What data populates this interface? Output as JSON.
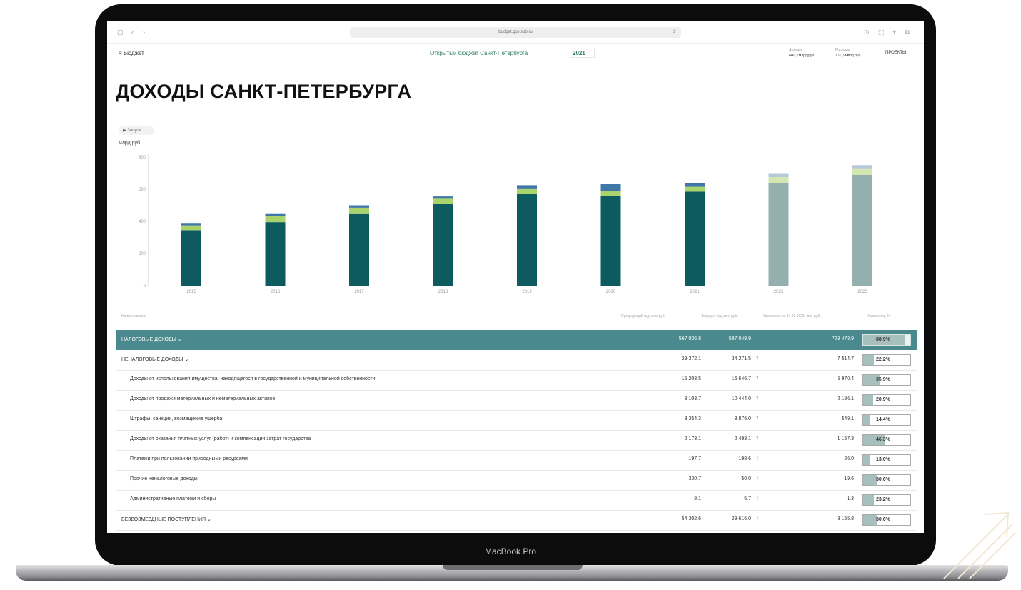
{
  "device": {
    "brand_label": "MacBook Pro"
  },
  "browser": {
    "url": "budget.gov.spb.ru",
    "zoom": "1"
  },
  "header": {
    "menu_label": "≡ Бюджет",
    "site_title": "Открытый бюджет Санкт-Петербурга",
    "year": "2021",
    "stats": [
      {
        "key": "Доходы",
        "value": "641,7 млрд руб."
      },
      {
        "key": "Расходы",
        "value": "761,5 млрд руб."
      }
    ],
    "projects_label": "ПРОЕКТЫ"
  },
  "page_title": "ДОХОДЫ САНКТ-ПЕТЕРБУРГА",
  "play_button_label": "▶ Запуск",
  "unit_label": "млрд руб.",
  "chart_data": {
    "type": "bar",
    "stacked": true,
    "categories": [
      "2015",
      "2016",
      "2017",
      "2018",
      "2019",
      "2020",
      "2021",
      "2022",
      "2023"
    ],
    "series": [
      {
        "values": [
          345,
          395,
          450,
          510,
          570,
          560,
          585,
          640,
          690
        ]
      },
      {
        "values": [
          30,
          40,
          35,
          35,
          35,
          30,
          30,
          35,
          40
        ]
      },
      {
        "values": [
          15,
          15,
          15,
          10,
          20,
          45,
          25,
          25,
          20
        ]
      }
    ],
    "forecast_from_index": 7,
    "ylim": [
      0,
      800
    ],
    "yticks": [
      0,
      200,
      400,
      600,
      800
    ],
    "colors": {
      "main": "#0d5b5f",
      "second": "#a9d36b",
      "third": "#3f78a8",
      "forecast_main": "#94b0ae",
      "forecast_second": "#d3e8b0",
      "forecast_third": "#b8c8d6"
    }
  },
  "table": {
    "headers": [
      "Наименование",
      "Предыдущий год, млн руб.",
      "Текущий год, млн руб.",
      "Исполнено на 01.01.2021, млн руб.",
      "Исполнено, %"
    ],
    "rows": [
      {
        "label": "НАЛОГОВЫЕ ДОХОДЫ ⌄",
        "prev": "567 036.8",
        "cur": "587 049.9",
        "arrow": "",
        "done": "729 478.9",
        "percent": "88.9%",
        "pct_value": 88.9,
        "level": 0,
        "highlight": true
      },
      {
        "label": "НЕНАЛОГОВЫЕ ДОХОДЫ ⌄",
        "prev": "29 372.1",
        "cur": "34 271.5",
        "arrow": "↑",
        "done": "7 514.7",
        "percent": "22.2%",
        "pct_value": 22.2,
        "level": 0,
        "highlight": false
      },
      {
        "label": "Доходы от использования имущества, находящегося в государственной и муниципальной собственности",
        "prev": "15 203.5",
        "cur": "16 646.7",
        "arrow": "↑",
        "done": "5 970.4",
        "percent": "35.9%",
        "pct_value": 35.9,
        "level": 1,
        "highlight": false
      },
      {
        "label": "Доходы от продажи материальных и нематериальных активов",
        "prev": "8 103.7",
        "cur": "10 444.0",
        "arrow": "↑",
        "done": "2 186.1",
        "percent": "20.9%",
        "pct_value": 20.9,
        "level": 1,
        "highlight": false
      },
      {
        "label": "Штрафы, санкции, возмещение ущерба",
        "prev": "3 354.3",
        "cur": "3 876.0",
        "arrow": "↑",
        "done": "549.1",
        "percent": "14.4%",
        "pct_value": 14.4,
        "level": 1,
        "highlight": false
      },
      {
        "label": "Доходы от оказания платных услуг (работ) и компенсации затрат государства",
        "prev": "2 173.1",
        "cur": "2 493.1",
        "arrow": "↑",
        "done": "1 157.3",
        "percent": "46.3%",
        "pct_value": 46.3,
        "level": 1,
        "highlight": false
      },
      {
        "label": "Платежи при пользовании природными ресурсами",
        "prev": "197.7",
        "cur": "198.6",
        "arrow": "↓",
        "done": "26.0",
        "percent": "13.0%",
        "pct_value": 13.0,
        "level": 1,
        "highlight": false
      },
      {
        "label": "Прочие неналоговые доходы",
        "prev": "330.7",
        "cur": "50.0",
        "arrow": "↓",
        "done": "19.6",
        "percent": "30.6%",
        "pct_value": 30.6,
        "level": 1,
        "highlight": false
      },
      {
        "label": "Административные платежи и сборы",
        "prev": "8.1",
        "cur": "5.7",
        "arrow": "↓",
        "done": "1.3",
        "percent": "23.2%",
        "pct_value": 23.2,
        "level": 1,
        "highlight": false
      },
      {
        "label": "БЕЗВОЗМЕЗДНЫЕ ПОСТУПЛЕНИЯ ⌄",
        "prev": "54 302.6",
        "cur": "29 616.0",
        "arrow": "↓",
        "done": "8 155.8",
        "percent": "30.6%",
        "pct_value": 30.6,
        "level": 0,
        "highlight": false
      }
    ]
  }
}
